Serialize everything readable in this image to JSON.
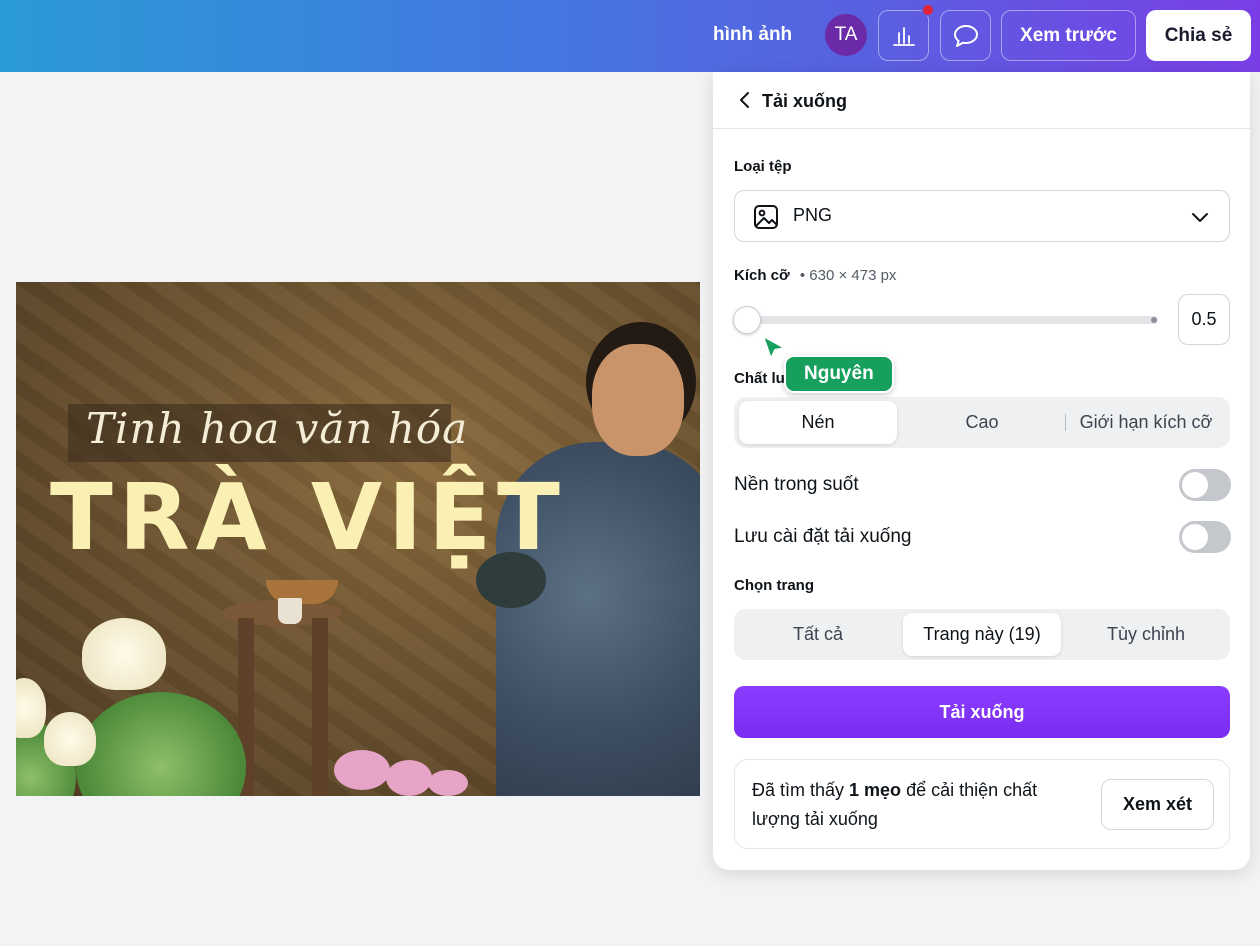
{
  "topbar": {
    "file_name": "hình ảnh",
    "avatar_initials": "TA",
    "preview_label": "Xem trước",
    "share_label": "Chia sẻ",
    "notification_color": "#e0223a"
  },
  "design": {
    "script_title": "Tinh hoa văn hóa",
    "big_title": "TRÀ VIỆT"
  },
  "panel": {
    "title": "Tải xuống",
    "file_type_label": "Loại tệp",
    "file_type_value": "PNG",
    "size_label": "Kích cỡ",
    "size_dims": "• 630 × 473 px",
    "size_value": "0.5",
    "slider_fraction": 0.0,
    "collaborator_name": "Nguyên",
    "collaborator_color": "#17a05d",
    "quality_label": "Chất lượng",
    "quality_options": [
      "Nén",
      "Cao",
      "Giới hạn kích cỡ"
    ],
    "quality_selected": "Nén",
    "transparent_bg_label": "Nền trong suốt",
    "transparent_bg_on": false,
    "save_settings_label": "Lưu cài đặt tải xuống",
    "save_settings_on": false,
    "pages_label": "Chọn trang",
    "page_options": [
      "Tất cả",
      "Trang này (19)",
      "Tùy chỉnh"
    ],
    "page_selected": "Trang này (19)",
    "download_button": "Tải xuống",
    "download_color": "#8b3dff",
    "tip_prefix": "Đã tìm thấy ",
    "tip_bold": "1 mẹo",
    "tip_suffix": " để cải thiện chất lượng tải xuống",
    "review_button": "Xem xét"
  }
}
